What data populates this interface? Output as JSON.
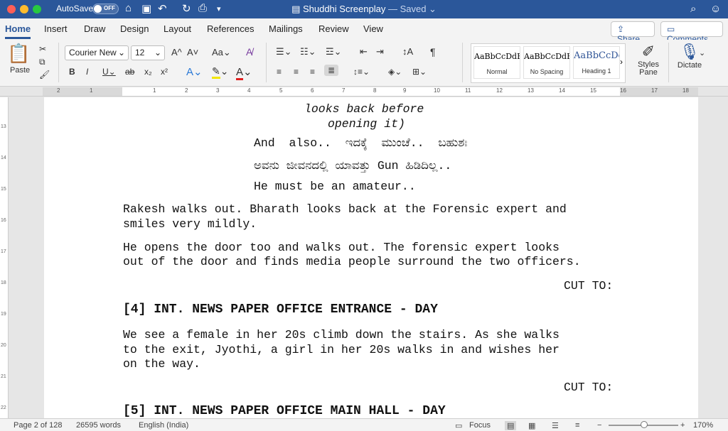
{
  "titlebar": {
    "autosave": "AutoSave",
    "toggle": "OFF",
    "doc_name": "Shuddhi Screenplay",
    "saved": "— Saved ⌄",
    "icons": [
      "home-icon",
      "save-icon",
      "undo-icon",
      "redo-icon",
      "print-icon",
      "customize-icon",
      "search-icon",
      "user-icon"
    ]
  },
  "tabs": [
    "Home",
    "Insert",
    "Draw",
    "Design",
    "Layout",
    "References",
    "Mailings",
    "Review",
    "View"
  ],
  "share": "Share",
  "comments": "Comments",
  "ribbon": {
    "paste": "Paste",
    "font": "Courier New",
    "size": "12",
    "styles": [
      {
        "sample": "AaBbCcDdEe",
        "name": "Normal"
      },
      {
        "sample": "AaBbCcDdEe",
        "name": "No Spacing"
      },
      {
        "sample": "AaBbCcDc",
        "name": "Heading 1"
      }
    ],
    "styles_pane": "Styles Pane",
    "dictate": "Dictate"
  },
  "ruler": [
    "2",
    "1",
    "1",
    "2",
    "3",
    "4",
    "5",
    "6",
    "7",
    "8",
    "9",
    "10",
    "11",
    "12",
    "13",
    "14",
    "15",
    "16",
    "17",
    "18"
  ],
  "vruler": [
    "13",
    "14",
    "15",
    "16",
    "17",
    "18",
    "19",
    "20",
    "21",
    "22"
  ],
  "document": {
    "line1": "looks back before",
    "line2": "opening it)",
    "line3": "And  also..  ಇದಕ್ಕೆ  ಮುಂಚೆ..  ಬಹುಶಃ",
    "line4": "ಅವನು ಜೀವನದಲ್ಲಿ ಯಾವತ್ತು Gun ಹಿಡಿದಿಲ್ಲ..",
    "line5": "He must be an amateur..",
    "para1a": "Rakesh walks out. Bharath looks back at the Forensic expert and",
    "para1b": "smiles very mildly.",
    "para2a": "He opens the door too and walks out. The forensic expert looks",
    "para2b": "out of the door and finds media people surround the two officers.",
    "cut1": "CUT TO:",
    "scene4": "[4] INT. NEWS PAPER OFFICE ENTRANCE - DAY",
    "para3a": "We see a female in her 20s climb down the stairs. As she walks",
    "para3b": "to the exit, Jyothi, a girl in her 20s walks in and wishes her",
    "para3c": "on the way.",
    "cut2": "CUT TO:",
    "scene5": "[5] INT. NEWS PAPER OFFICE MAIN HALL - DAY"
  },
  "status": {
    "page": "Page 2 of 128",
    "words": "26595 words",
    "language": "English (India)",
    "focus": "Focus",
    "zoom": "170%"
  },
  "colors": {
    "accent": "#2b579a"
  }
}
